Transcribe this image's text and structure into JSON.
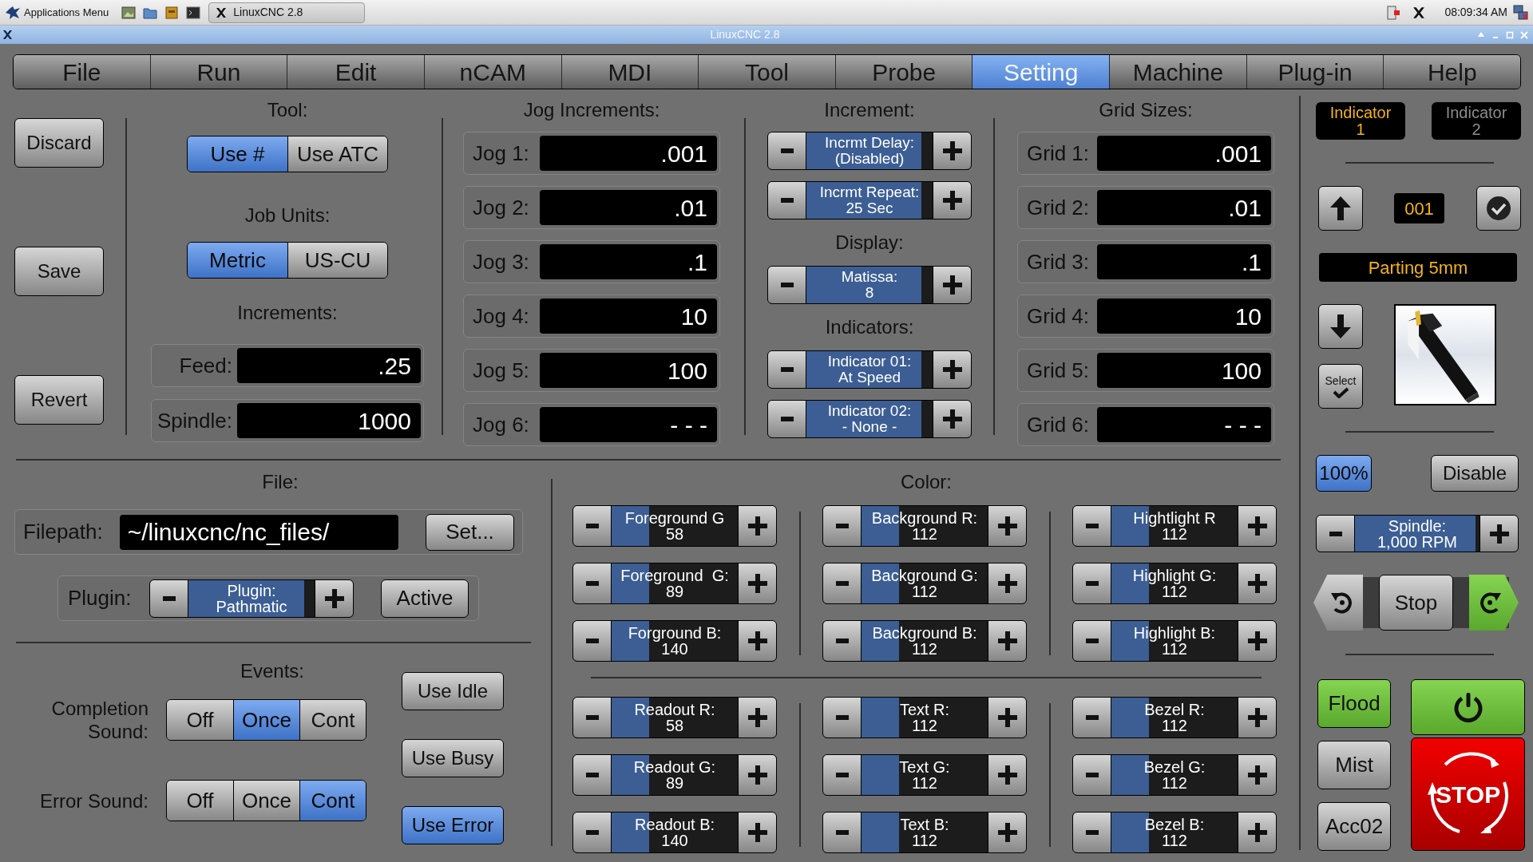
{
  "taskbar": {
    "menu": "Applications Menu",
    "task": "LinuxCNC 2.8",
    "clock": "08:09:34 AM"
  },
  "window": {
    "title": "LinuxCNC 2.8"
  },
  "tabs": [
    {
      "label": "File",
      "selected": false
    },
    {
      "label": "Run",
      "selected": false
    },
    {
      "label": "Edit",
      "selected": false
    },
    {
      "label": "nCAM",
      "selected": false
    },
    {
      "label": "MDI",
      "selected": false
    },
    {
      "label": "Tool",
      "selected": false
    },
    {
      "label": "Probe",
      "selected": false
    },
    {
      "label": "Setting",
      "selected": true
    },
    {
      "label": "Machine",
      "selected": false
    },
    {
      "label": "Plug-in",
      "selected": false
    },
    {
      "label": "Help",
      "selected": false
    }
  ],
  "actions": [
    "Discard",
    "Save",
    "Revert"
  ],
  "tool": {
    "title": "Tool:",
    "modes": [
      {
        "label": "Use #",
        "selected": true
      },
      {
        "label": "Use ATC",
        "selected": false
      }
    ],
    "units_title": "Job Units:",
    "units": [
      {
        "label": "Metric",
        "selected": true
      },
      {
        "label": "US-CU",
        "selected": false
      }
    ],
    "increments_title": "Increments:",
    "fields": [
      {
        "label": "Feed:",
        "value": ".25"
      },
      {
        "label": "Spindle:",
        "value": "1000"
      }
    ]
  },
  "jog": {
    "title": "Jog Increments:",
    "rows": [
      {
        "label": "Jog 1:",
        "value": ".001"
      },
      {
        "label": "Jog 2:",
        "value": ".01"
      },
      {
        "label": "Jog 3:",
        "value": ".1"
      },
      {
        "label": "Jog 4:",
        "value": "10"
      },
      {
        "label": "Jog 5:",
        "value": "100"
      },
      {
        "label": "Jog 6:",
        "value": "- - -"
      }
    ]
  },
  "increment": {
    "title": "Increment:",
    "items": [
      {
        "kind": "stepper",
        "label": "Incrmt Delay:",
        "value": "(Disabled)",
        "level": 0.91
      },
      {
        "kind": "stepper",
        "label": "Incrmt Repeat:",
        "value": "25 Sec",
        "level": 0.91
      },
      {
        "kind": "heading",
        "label": "Display:"
      },
      {
        "kind": "stepper",
        "label": "Matissa:",
        "value": "8",
        "level": 0.91
      },
      {
        "kind": "heading",
        "label": "Indicators:"
      },
      {
        "kind": "stepper",
        "label": "Indicator 01:",
        "value": "At Speed",
        "level": 0.91
      },
      {
        "kind": "stepper",
        "label": "Indicator 02:",
        "value": "- None -",
        "level": 0.91
      }
    ]
  },
  "grid": {
    "title": "Grid Sizes:",
    "rows": [
      {
        "label": "Grid 1:",
        "value": ".001"
      },
      {
        "label": "Grid 2:",
        "value": ".01"
      },
      {
        "label": "Grid 3:",
        "value": ".1"
      },
      {
        "label": "Grid 4:",
        "value": "10"
      },
      {
        "label": "Grid 5:",
        "value": "100"
      },
      {
        "label": "Grid 6:",
        "value": "- - -"
      }
    ]
  },
  "file": {
    "title": "File:",
    "filepath_label": "Filepath:",
    "filepath": "~/linuxcnc/nc_files/",
    "set_button": "Set...",
    "plugin_label": "Plugin:",
    "plugin": {
      "label": "Plugin:",
      "value": "Pathmatic",
      "level": 0.92
    },
    "active_button": "Active"
  },
  "events": {
    "title": "Events:",
    "sounds": [
      {
        "label": "Completion Sound:",
        "options": [
          {
            "label": "Off",
            "selected": false
          },
          {
            "label": "Once",
            "selected": true
          },
          {
            "label": "Cont",
            "selected": false
          }
        ]
      },
      {
        "label": "Error Sound:",
        "options": [
          {
            "label": "Off",
            "selected": false
          },
          {
            "label": "Once",
            "selected": false
          },
          {
            "label": "Cont",
            "selected": true
          }
        ]
      }
    ],
    "buttons": [
      {
        "label": "Use Idle",
        "selected": false
      },
      {
        "label": "Use Busy",
        "selected": false
      },
      {
        "label": "Use Error",
        "selected": true
      }
    ]
  },
  "color": {
    "title": "Color:",
    "top": [
      [
        {
          "label": "Foreground G",
          "value": "58",
          "level": 0.3
        },
        {
          "label": "Foreground  G:",
          "value": "89",
          "level": 0.3
        },
        {
          "label": "Forground B:",
          "value": "140",
          "level": 0.3
        }
      ],
      [
        {
          "label": "Background R:",
          "value": "112",
          "level": 0.3
        },
        {
          "label": "Background G:",
          "value": "112",
          "level": 0.3
        },
        {
          "label": "Background B:",
          "value": "112",
          "level": 0.3
        }
      ],
      [
        {
          "label": "Hightlight R",
          "value": "112",
          "level": 0.3
        },
        {
          "label": "Highlight G:",
          "value": "112",
          "level": 0.3
        },
        {
          "label": "Highlight B:",
          "value": "112",
          "level": 0.3
        }
      ]
    ],
    "bottom": [
      [
        {
          "label": "Readout R:",
          "value": "58",
          "level": 0.3
        },
        {
          "label": "Readout G:",
          "value": "89",
          "level": 0.3
        },
        {
          "label": "Readout B:",
          "value": "140",
          "level": 0.3
        }
      ],
      [
        {
          "label": "Text R:",
          "value": "112",
          "level": 0.3
        },
        {
          "label": "Text G:",
          "value": "112",
          "level": 0.3
        },
        {
          "label": "Text B:",
          "value": "112",
          "level": 0.3
        }
      ],
      [
        {
          "label": "Bezel R:",
          "value": "112",
          "level": 0.3
        },
        {
          "label": "Bezel G:",
          "value": "112",
          "level": 0.3
        },
        {
          "label": "Bezel B:",
          "value": "112",
          "level": 0.3
        }
      ]
    ]
  },
  "side": {
    "indicators": [
      {
        "label": "Indicator 1",
        "selected": true
      },
      {
        "label": "Indicator 2",
        "selected": false
      }
    ],
    "tool_number": "001",
    "tool_name": "Parting 5mm",
    "select_button": "Select",
    "override": {
      "label": "100%",
      "selected": true
    },
    "disable_button": "Disable",
    "spindle": {
      "label": "Spindle:",
      "value": "1,000 RPM",
      "level": 0.97
    },
    "rotation": [
      {
        "kind": "reverse",
        "selected": false
      },
      {
        "kind": "stop",
        "label": "Stop",
        "selected": false
      },
      {
        "kind": "forward",
        "selected": true
      }
    ],
    "coolant": [
      {
        "label": "Flood",
        "on": true
      },
      {
        "label": "Mist",
        "on": false
      },
      {
        "label": "Acc02",
        "on": false
      }
    ],
    "power": {
      "on": true
    },
    "estop": "STOP"
  }
}
